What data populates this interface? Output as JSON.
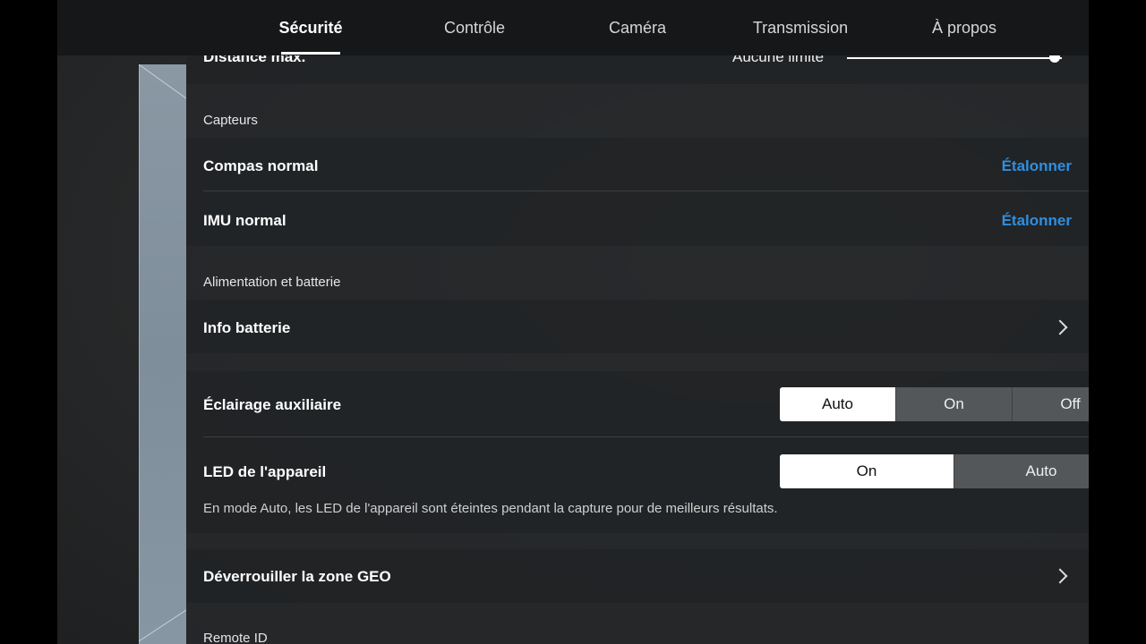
{
  "tabs": [
    {
      "label": "Sécurité",
      "active": true
    },
    {
      "label": "Contrôle",
      "active": false
    },
    {
      "label": "Caméra",
      "active": false
    },
    {
      "label": "Transmission",
      "active": false
    },
    {
      "label": "À propos",
      "active": false
    }
  ],
  "distance": {
    "label": "Distance max.",
    "value": "Aucune limite",
    "slider_fraction": 1.0
  },
  "sensors": {
    "section_title": "Capteurs",
    "compass": {
      "label": "Compas normal",
      "action": "Étalonner"
    },
    "imu": {
      "label": "IMU normal",
      "action": "Étalonner"
    }
  },
  "power": {
    "section_title": "Alimentation et batterie",
    "battery_info": {
      "label": "Info batterie"
    }
  },
  "aux_light": {
    "label": "Éclairage auxiliaire",
    "options": [
      "Auto",
      "On",
      "Off"
    ],
    "selected": "Auto"
  },
  "device_led": {
    "label": "LED de l'appareil",
    "options": [
      "On",
      "Auto"
    ],
    "selected": "On",
    "note": "En mode Auto, les LED de l'appareil sont éteintes pendant la capture pour de meilleurs résultats."
  },
  "geo": {
    "label": "Déverrouiller la zone GEO"
  },
  "remote_id": {
    "section_title": "Remote ID"
  },
  "colors": {
    "accent": "#2f8fe0",
    "selected_segment": "#ffffff"
  },
  "icons": [
    "chevron-right-icon"
  ]
}
